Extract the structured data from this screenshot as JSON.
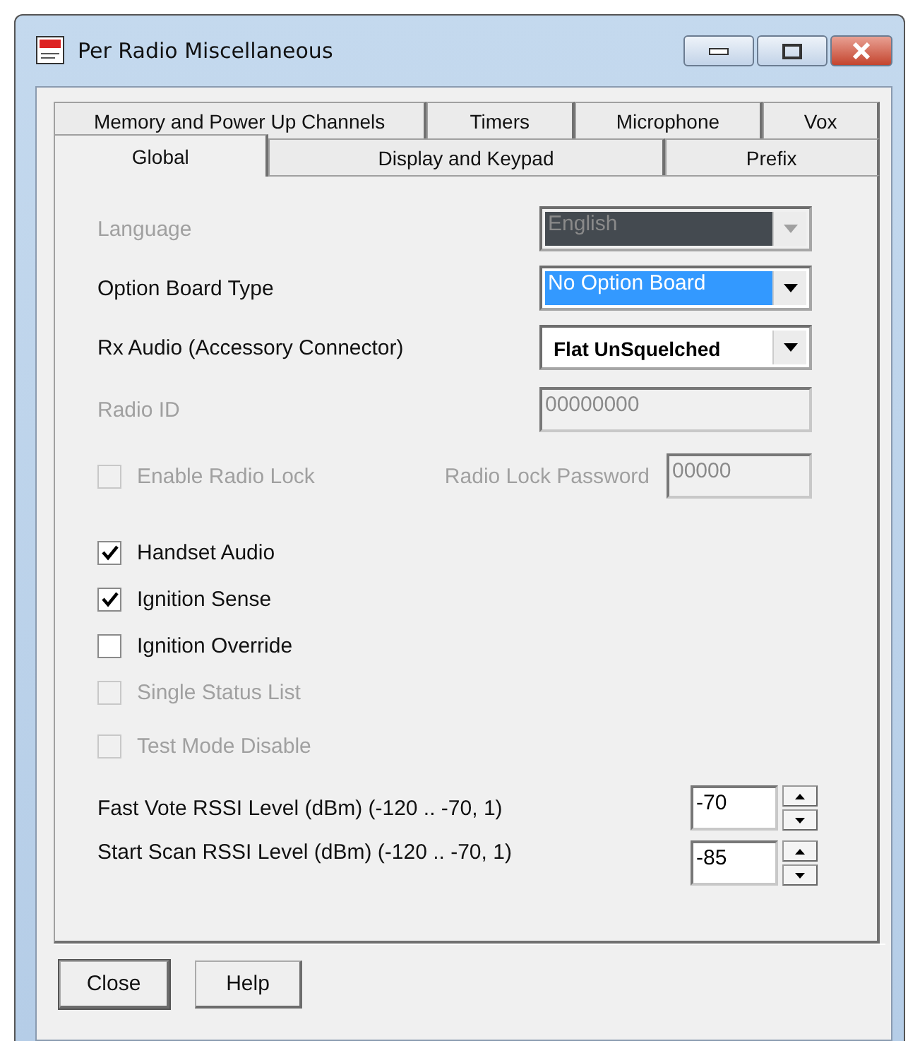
{
  "window": {
    "title": "Per Radio Miscellaneous"
  },
  "tab_rows": [
    [
      {
        "label": "Memory and Power Up Channels",
        "selected": false
      },
      {
        "label": "Timers",
        "selected": false
      },
      {
        "label": "Microphone",
        "selected": false
      },
      {
        "label": "Vox",
        "selected": false
      }
    ],
    [
      {
        "label": "Global",
        "selected": true
      },
      {
        "label": "Display and Keypad",
        "selected": false
      },
      {
        "label": "Prefix",
        "selected": false
      }
    ]
  ],
  "fields": [
    {
      "kind": "combo",
      "label": "Language",
      "value": "English",
      "disabled": true,
      "selected": false,
      "bold": false
    },
    {
      "kind": "combo",
      "label": "Option Board Type",
      "value": "No Option Board",
      "disabled": false,
      "selected": true,
      "bold": false
    },
    {
      "kind": "combo",
      "label": "Rx Audio (Accessory Connector)",
      "value": "Flat UnSquelched",
      "disabled": false,
      "selected": false,
      "bold": true
    },
    {
      "kind": "text",
      "label": "Radio ID",
      "value": "00000000",
      "disabled": true
    }
  ],
  "radio_lock": {
    "label": "Enable Radio Lock",
    "checked": false,
    "disabled": true,
    "password_label": "Radio Lock Password",
    "password": "00000"
  },
  "checkboxes": [
    {
      "label": "Handset Audio",
      "checked": true,
      "disabled": false
    },
    {
      "label": "Ignition Sense",
      "checked": true,
      "disabled": false
    },
    {
      "label": "Ignition Override",
      "checked": false,
      "disabled": false
    },
    {
      "label": "Single Status List",
      "checked": false,
      "disabled": true
    },
    {
      "label": "Test Mode Disable",
      "checked": false,
      "disabled": true
    }
  ],
  "spinners": [
    {
      "label": "Fast Vote RSSI Level (dBm) (-120 .. -70, 1)",
      "value": "-70"
    },
    {
      "label": "Start Scan RSSI Level (dBm) (-120 .. -70, 1)",
      "value": "-85"
    }
  ],
  "buttons": [
    "Close",
    "Help"
  ]
}
